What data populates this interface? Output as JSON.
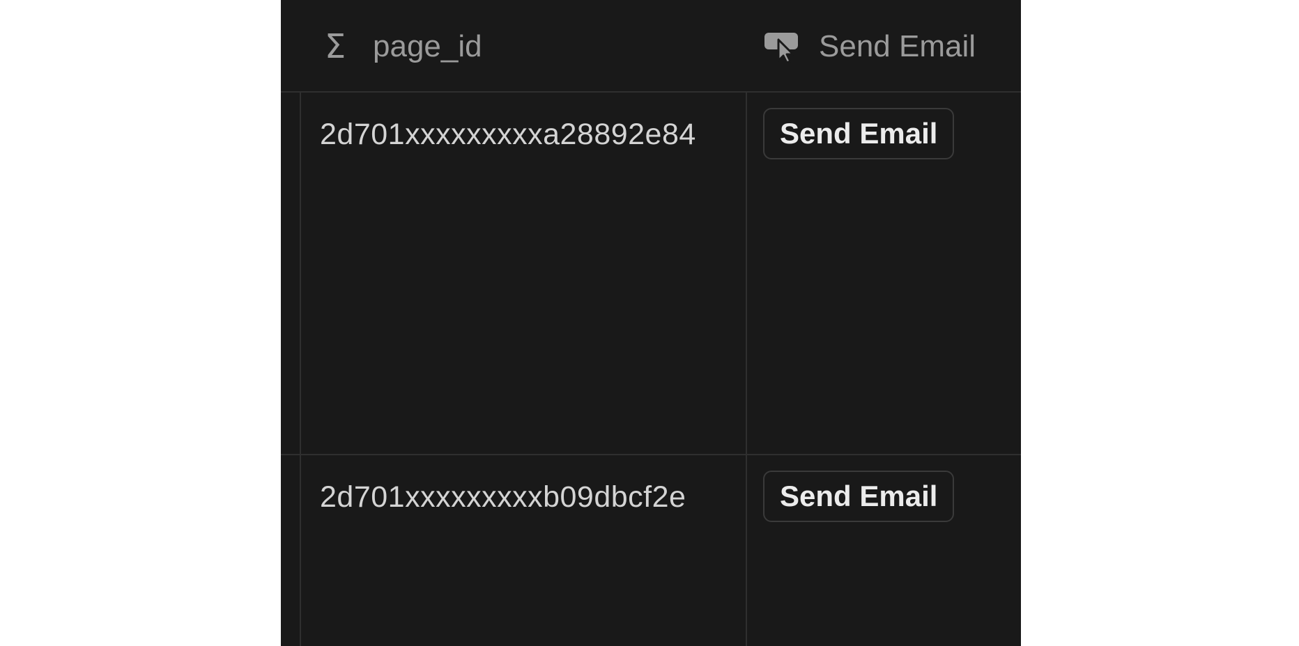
{
  "table": {
    "columns": [
      {
        "label": "page_id",
        "icon": "sigma-icon"
      },
      {
        "label": "Send Email",
        "icon": "button-cursor-icon"
      }
    ],
    "rows": [
      {
        "page_id": "2d701xxxxxxxxxa28892e84",
        "button_label": "Send Email"
      },
      {
        "page_id": "2d701xxxxxxxxxb09dbcf2e",
        "button_label": "Send Email"
      }
    ]
  },
  "colors": {
    "background": "#191919",
    "border": "#2f2f2f",
    "header_text": "#9b9b9b",
    "cell_text": "#d4d4d4"
  }
}
